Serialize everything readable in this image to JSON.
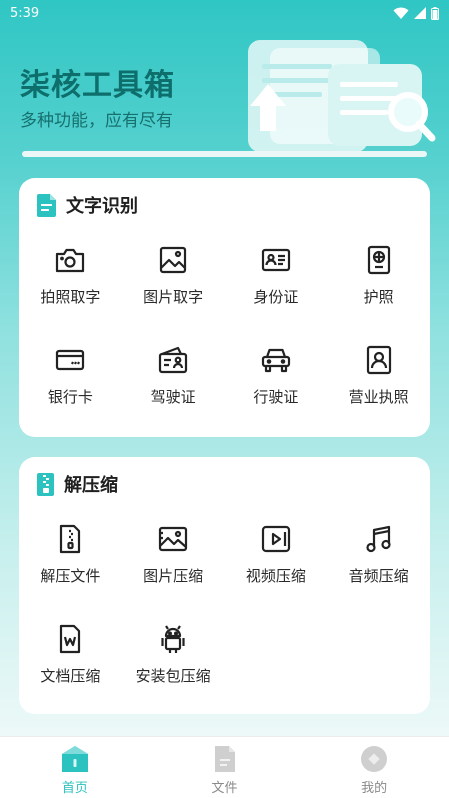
{
  "status_bar": {
    "time": "5:39"
  },
  "header": {
    "title": "柒核工具箱",
    "subtitle": "多种功能，应有尽有"
  },
  "sections": [
    {
      "title": "文字识别",
      "items": [
        {
          "label": "拍照取字",
          "icon": "camera-icon"
        },
        {
          "label": "图片取字",
          "icon": "image-icon"
        },
        {
          "label": "身份证",
          "icon": "id-card-icon"
        },
        {
          "label": "护照",
          "icon": "passport-icon"
        },
        {
          "label": "银行卡",
          "icon": "bank-card-icon"
        },
        {
          "label": "驾驶证",
          "icon": "driver-license-icon"
        },
        {
          "label": "行驶证",
          "icon": "car-icon"
        },
        {
          "label": "营业执照",
          "icon": "business-license-icon"
        }
      ]
    },
    {
      "title": "解压缩",
      "items": [
        {
          "label": "解压文件",
          "icon": "zip-file-icon"
        },
        {
          "label": "图片压缩",
          "icon": "image-compress-icon"
        },
        {
          "label": "视频压缩",
          "icon": "video-icon"
        },
        {
          "label": "音频压缩",
          "icon": "music-icon"
        },
        {
          "label": "文档压缩",
          "icon": "word-doc-icon"
        },
        {
          "label": "安装包压缩",
          "icon": "android-icon"
        }
      ]
    }
  ],
  "bottom_nav": [
    {
      "label": "首页",
      "icon": "home-icon",
      "active": true
    },
    {
      "label": "文件",
      "icon": "file-icon",
      "active": false
    },
    {
      "label": "我的",
      "icon": "profile-icon",
      "active": false
    }
  ],
  "colors": {
    "accent": "#2cc2c0",
    "title": "#0d6e6b",
    "icon_stroke": "#222222"
  }
}
